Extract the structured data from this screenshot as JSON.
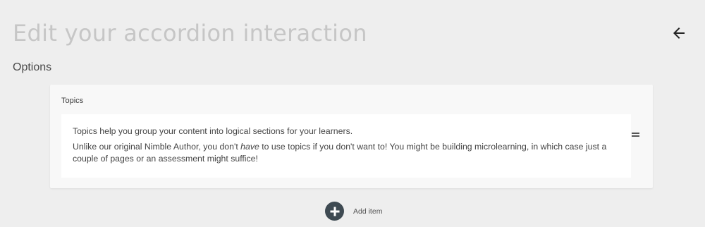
{
  "header": {
    "title": "Edit your accordion interaction",
    "back_icon": "arrow-left-icon"
  },
  "options": {
    "heading": "Options",
    "topics_card": {
      "label": "Topics",
      "paragraph1": "Topics help you group your content into logical sections for your learners.",
      "paragraph2_before": "Unlike our original Nimble Author, you don't ",
      "paragraph2_emphasis": "have",
      "paragraph2_after": " to use topics if you don't want to! You might be building microlearning, in which case just a couple of pages or an assessment might suffice!",
      "drag_icon": "drag-handle-icon"
    },
    "add_item": {
      "icon": "plus-circle-icon",
      "label": "Add item"
    }
  }
}
